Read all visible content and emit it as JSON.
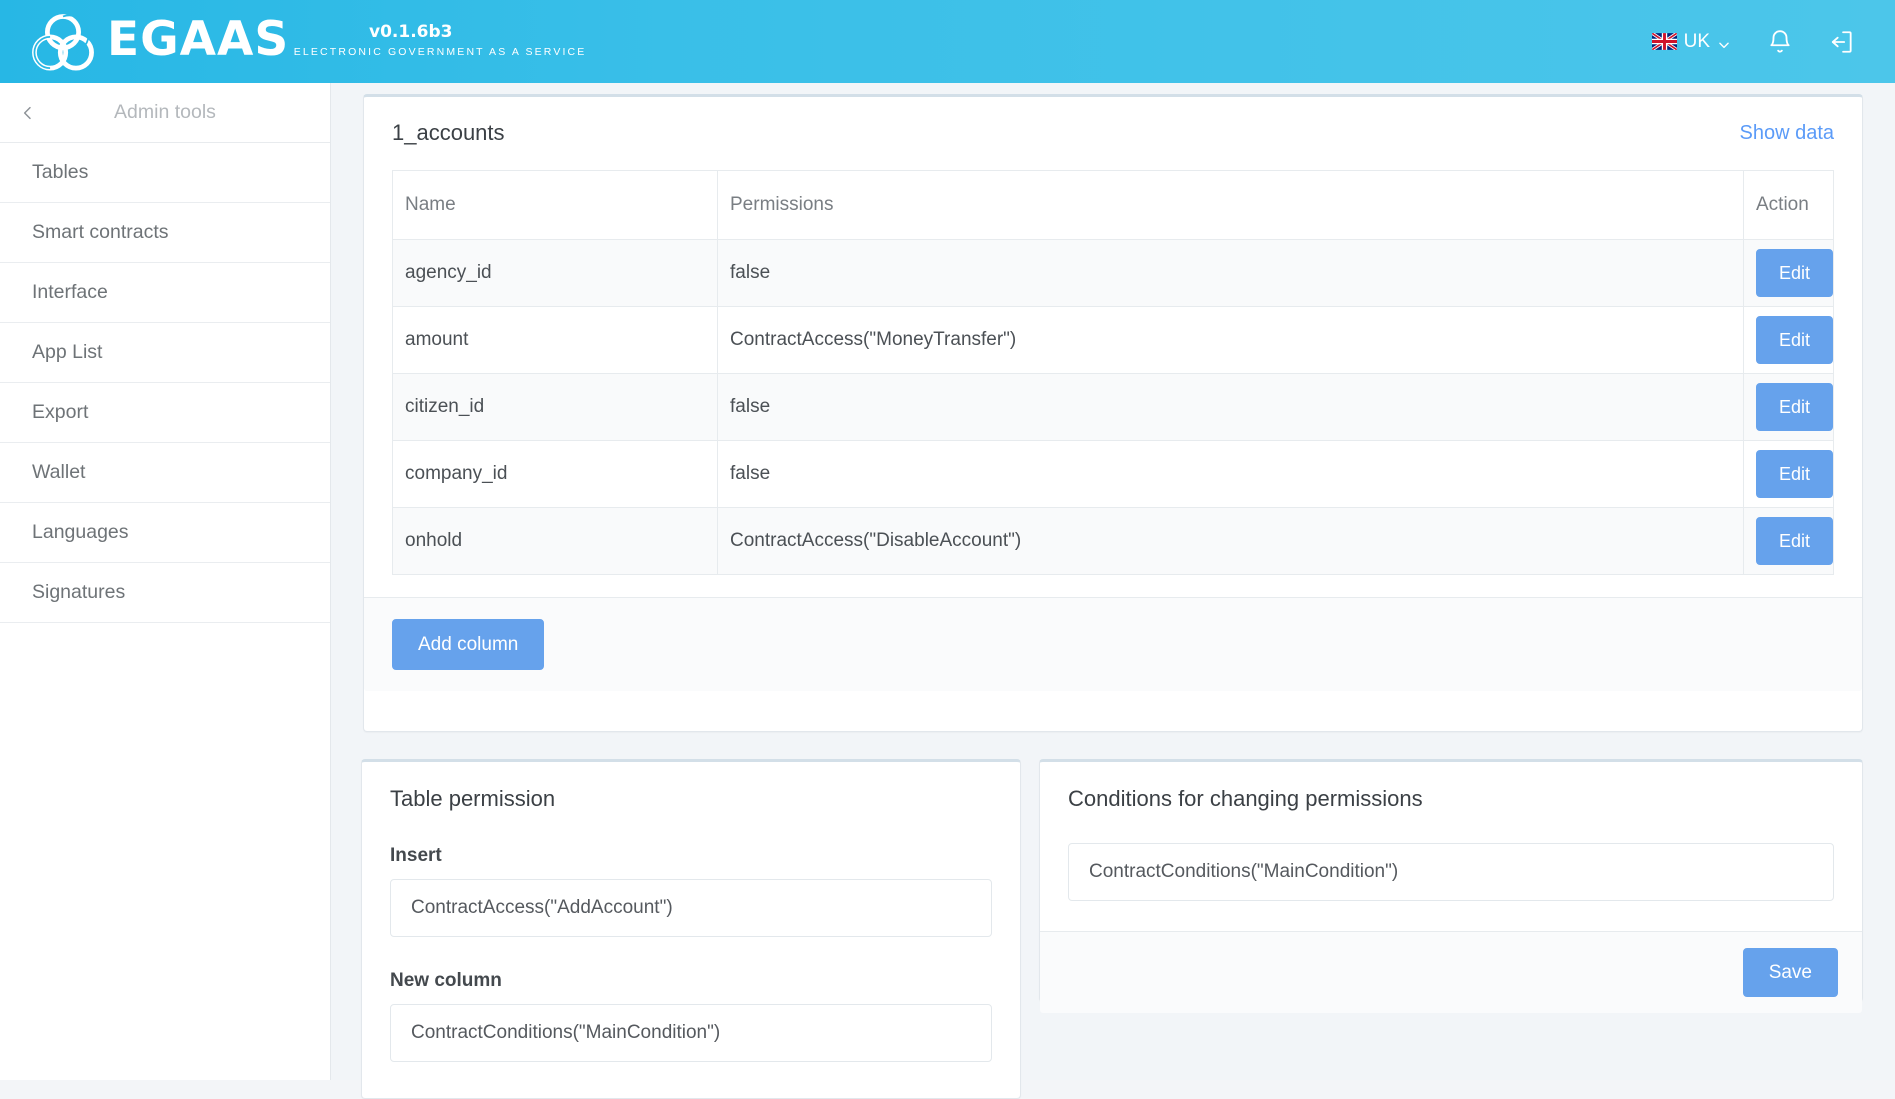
{
  "header": {
    "brand_word": "EGAAS",
    "brand_tagline": "ELECTRONIC GOVERNMENT AS A SERVICE",
    "version": "v0.1.6b3",
    "language": "UK",
    "icons": {
      "logo": "egaas-knot-logo",
      "flag": "uk-flag-icon",
      "chevron": "chevron-down-icon",
      "bell": "notifications-bell-icon",
      "logout": "logout-icon"
    },
    "accent_color": "#39bfe8"
  },
  "sidebar": {
    "back_label": "",
    "title": "Admin tools",
    "items": [
      {
        "label": "Tables"
      },
      {
        "label": "Smart contracts"
      },
      {
        "label": "Interface"
      },
      {
        "label": "App List"
      },
      {
        "label": "Export"
      },
      {
        "label": "Wallet"
      },
      {
        "label": "Languages"
      },
      {
        "label": "Signatures"
      }
    ]
  },
  "main": {
    "title": "1_accounts",
    "show_data_label": "Show data",
    "table": {
      "columns": [
        "Name",
        "Permissions",
        "Action"
      ],
      "rows": [
        {
          "name": "agency_id",
          "permissions": "false",
          "action": "Edit"
        },
        {
          "name": "amount",
          "permissions": "ContractAccess(\"MoneyTransfer\")",
          "action": "Edit"
        },
        {
          "name": "citizen_id",
          "permissions": "false",
          "action": "Edit"
        },
        {
          "name": "company_id",
          "permissions": "false",
          "action": "Edit"
        },
        {
          "name": "onhold",
          "permissions": "ContractAccess(\"DisableAccount\")",
          "action": "Edit"
        }
      ]
    },
    "add_column_label": "Add column"
  },
  "table_permission": {
    "title": "Table permission",
    "fields": [
      {
        "label": "Insert",
        "value": "ContractAccess(\"AddAccount\")"
      },
      {
        "label": "New column",
        "value": "ContractConditions(\"MainCondition\")"
      }
    ]
  },
  "conditions_panel": {
    "title": "Conditions for changing permissions",
    "value": "ContractConditions(\"MainCondition\")",
    "save_label": "Save"
  },
  "colors": {
    "primary_button": "#66a2ec",
    "link": "#5b9bf8",
    "header_gradient_start": "#27b7e5",
    "header_gradient_end": "#4cc6ea"
  }
}
